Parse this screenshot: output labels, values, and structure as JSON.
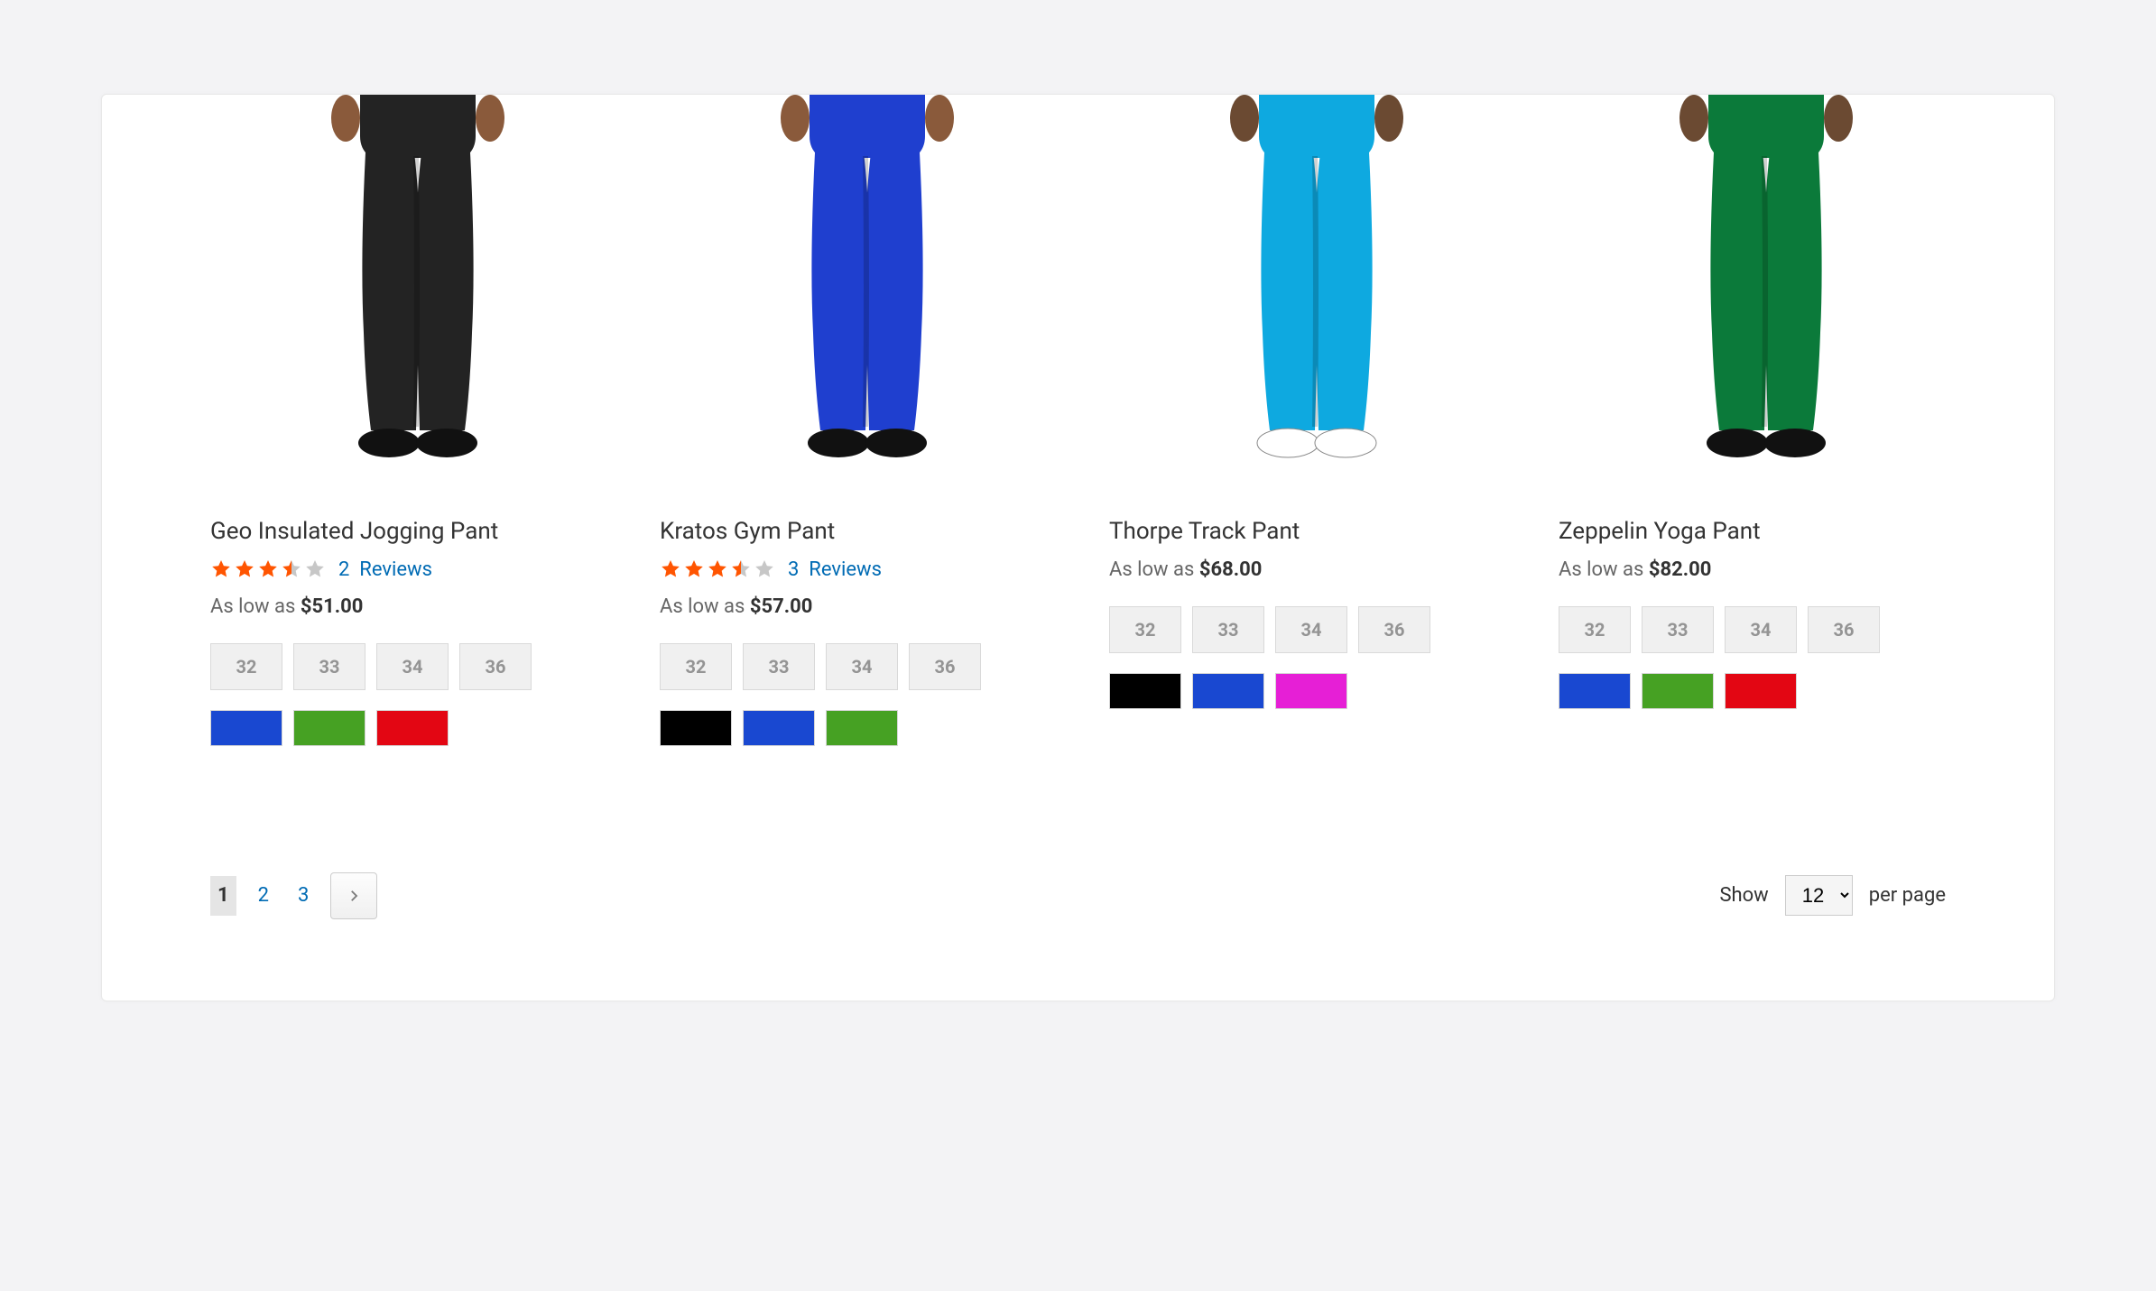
{
  "products": [
    {
      "name": "Geo Insulated Jogging Pant",
      "rating": 3.5,
      "reviews_count": "2",
      "reviews_label": "Reviews",
      "as_low_as_label": "As low as",
      "price": "$51.00",
      "sizes": [
        "32",
        "33",
        "34",
        "36"
      ],
      "colors": [
        "#1948d1",
        "#46a123",
        "#e30613"
      ],
      "image_pants_color": "#232323",
      "image_shoe_color": "#111111",
      "skin_tone": "#8a5a3b"
    },
    {
      "name": "Kratos Gym Pant",
      "rating": 3.5,
      "reviews_count": "3",
      "reviews_label": "Reviews",
      "as_low_as_label": "As low as",
      "price": "$57.00",
      "sizes": [
        "32",
        "33",
        "34",
        "36"
      ],
      "colors": [
        "#000000",
        "#1948d1",
        "#46a123"
      ],
      "image_pants_color": "#1f3fcf",
      "image_shoe_color": "#111111",
      "skin_tone": "#8a5a3b"
    },
    {
      "name": "Thorpe Track Pant",
      "rating": 0,
      "reviews_count": "",
      "reviews_label": "",
      "as_low_as_label": "As low as",
      "price": "$68.00",
      "sizes": [
        "32",
        "33",
        "34",
        "36"
      ],
      "colors": [
        "#000000",
        "#1948d1",
        "#e61fd6"
      ],
      "image_pants_color": "#0ea9e0",
      "image_shoe_color": "#ffffff",
      "skin_tone": "#6b4a32"
    },
    {
      "name": "Zeppelin Yoga Pant",
      "rating": 0,
      "reviews_count": "",
      "reviews_label": "",
      "as_low_as_label": "As low as",
      "price": "$82.00",
      "sizes": [
        "32",
        "33",
        "34",
        "36"
      ],
      "colors": [
        "#1948d1",
        "#46a123",
        "#e30613"
      ],
      "image_pants_color": "#0b7a3a",
      "image_shoe_color": "#111111",
      "skin_tone": "#6b4a32"
    }
  ],
  "pagination": {
    "current": "1",
    "pages": [
      "1",
      "2",
      "3"
    ]
  },
  "limiter": {
    "show_label": "Show",
    "per_page_label": "per page",
    "value": "12"
  },
  "star_colors": {
    "full": "#ff5501",
    "empty": "#c7c7c7"
  }
}
